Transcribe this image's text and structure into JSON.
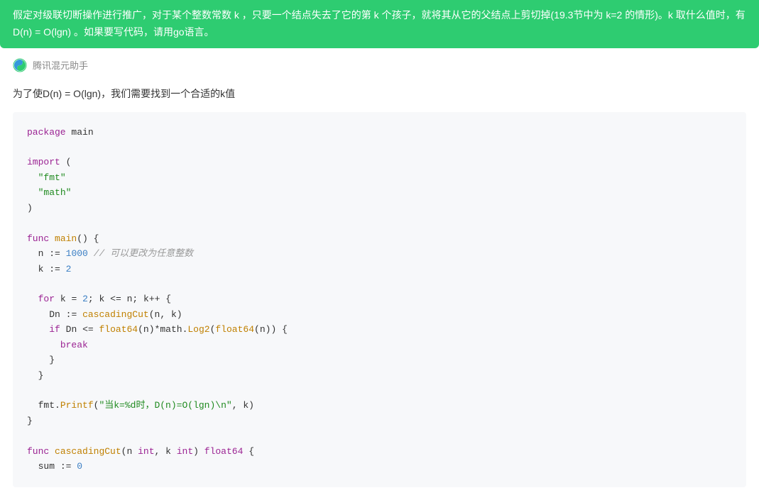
{
  "prompt": {
    "text": "假定对级联切断操作进行推广，对于某个整数常数 k ，只要一个结点失去了它的第 k 个孩子，就将其从它的父结点上剪切掉(19.3节中为 k=2 的情形)。k 取什么值时，有D(n) = O(lgn) 。如果要写代码，请用go语言。"
  },
  "assistant": {
    "name": "腾讯混元助手"
  },
  "answer": {
    "intro": "为了使D(n) = O(lgn)，我们需要找到一个合适的k值"
  },
  "code": {
    "kw_package": "package",
    "pkg_main": "main",
    "kw_import": "import",
    "str_fmt": "\"fmt\"",
    "str_math": "\"math\"",
    "kw_func": "func",
    "fn_main": "main",
    "var_n": "n",
    "op_decl": ":=",
    "num_1000": "1000",
    "comment_n": "// 可以更改为任意整数",
    "var_k": "k",
    "num_2": "2",
    "kw_for": "for",
    "op_assign": "=",
    "op_le": "<=",
    "op_inc": "++",
    "var_Dn": "Dn",
    "fn_cascadingCut": "cascadingCut",
    "kw_if": "if",
    "fn_float64": "float64",
    "op_mul": "*",
    "pkg_math": "math",
    "fn_Log2": "Log2",
    "kw_break": "break",
    "pkg_fmt": "fmt",
    "fn_Printf": "Printf",
    "str_printf": "\"当k=%d时，D(n)=O(lgn)\\n\"",
    "kw_int": "int",
    "kw_float64_ret": "float64",
    "var_sum": "sum",
    "num_0": "0"
  }
}
